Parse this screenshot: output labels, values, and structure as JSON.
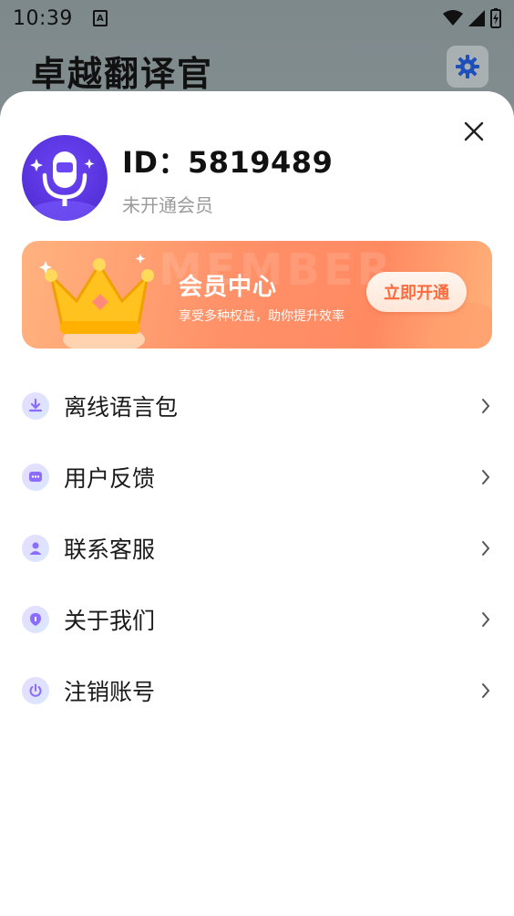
{
  "status_bar": {
    "time": "10:39",
    "app_icon_letter": "A"
  },
  "app": {
    "title": "卓越翻译官"
  },
  "profile": {
    "id_text": "ID：5819489",
    "membership_status": "未开通会员"
  },
  "vip_banner": {
    "bg_word": "MEMBER",
    "title": "会员中心",
    "subtitle": "享受多种权益，助你提升效率",
    "button_label": "立即开通"
  },
  "menu": {
    "items": [
      {
        "label": "离线语言包",
        "icon": "download-icon"
      },
      {
        "label": "用户反馈",
        "icon": "feedback-icon"
      },
      {
        "label": "联系客服",
        "icon": "user-icon"
      },
      {
        "label": "关于我们",
        "icon": "info-icon"
      },
      {
        "label": "注销账号",
        "icon": "power-icon"
      }
    ]
  },
  "colors": {
    "accent_purple": "#5a35e0",
    "vip_orange": "#ff8a62",
    "vip_button_text": "#ff6a3d"
  }
}
